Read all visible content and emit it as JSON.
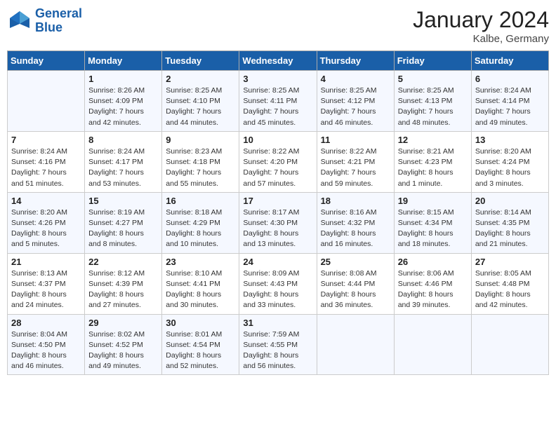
{
  "header": {
    "title": "January 2024",
    "location": "Kalbe, Germany"
  },
  "logo": {
    "line1": "General",
    "line2": "Blue"
  },
  "days_header": [
    "Sunday",
    "Monday",
    "Tuesday",
    "Wednesday",
    "Thursday",
    "Friday",
    "Saturday"
  ],
  "weeks": [
    [
      {
        "day": "",
        "sunrise": "",
        "sunset": "",
        "daylight": ""
      },
      {
        "day": "1",
        "sunrise": "Sunrise: 8:26 AM",
        "sunset": "Sunset: 4:09 PM",
        "daylight": "Daylight: 7 hours and 42 minutes."
      },
      {
        "day": "2",
        "sunrise": "Sunrise: 8:25 AM",
        "sunset": "Sunset: 4:10 PM",
        "daylight": "Daylight: 7 hours and 44 minutes."
      },
      {
        "day": "3",
        "sunrise": "Sunrise: 8:25 AM",
        "sunset": "Sunset: 4:11 PM",
        "daylight": "Daylight: 7 hours and 45 minutes."
      },
      {
        "day": "4",
        "sunrise": "Sunrise: 8:25 AM",
        "sunset": "Sunset: 4:12 PM",
        "daylight": "Daylight: 7 hours and 46 minutes."
      },
      {
        "day": "5",
        "sunrise": "Sunrise: 8:25 AM",
        "sunset": "Sunset: 4:13 PM",
        "daylight": "Daylight: 7 hours and 48 minutes."
      },
      {
        "day": "6",
        "sunrise": "Sunrise: 8:24 AM",
        "sunset": "Sunset: 4:14 PM",
        "daylight": "Daylight: 7 hours and 49 minutes."
      }
    ],
    [
      {
        "day": "7",
        "sunrise": "Sunrise: 8:24 AM",
        "sunset": "Sunset: 4:16 PM",
        "daylight": "Daylight: 7 hours and 51 minutes."
      },
      {
        "day": "8",
        "sunrise": "Sunrise: 8:24 AM",
        "sunset": "Sunset: 4:17 PM",
        "daylight": "Daylight: 7 hours and 53 minutes."
      },
      {
        "day": "9",
        "sunrise": "Sunrise: 8:23 AM",
        "sunset": "Sunset: 4:18 PM",
        "daylight": "Daylight: 7 hours and 55 minutes."
      },
      {
        "day": "10",
        "sunrise": "Sunrise: 8:22 AM",
        "sunset": "Sunset: 4:20 PM",
        "daylight": "Daylight: 7 hours and 57 minutes."
      },
      {
        "day": "11",
        "sunrise": "Sunrise: 8:22 AM",
        "sunset": "Sunset: 4:21 PM",
        "daylight": "Daylight: 7 hours and 59 minutes."
      },
      {
        "day": "12",
        "sunrise": "Sunrise: 8:21 AM",
        "sunset": "Sunset: 4:23 PM",
        "daylight": "Daylight: 8 hours and 1 minute."
      },
      {
        "day": "13",
        "sunrise": "Sunrise: 8:20 AM",
        "sunset": "Sunset: 4:24 PM",
        "daylight": "Daylight: 8 hours and 3 minutes."
      }
    ],
    [
      {
        "day": "14",
        "sunrise": "Sunrise: 8:20 AM",
        "sunset": "Sunset: 4:26 PM",
        "daylight": "Daylight: 8 hours and 5 minutes."
      },
      {
        "day": "15",
        "sunrise": "Sunrise: 8:19 AM",
        "sunset": "Sunset: 4:27 PM",
        "daylight": "Daylight: 8 hours and 8 minutes."
      },
      {
        "day": "16",
        "sunrise": "Sunrise: 8:18 AM",
        "sunset": "Sunset: 4:29 PM",
        "daylight": "Daylight: 8 hours and 10 minutes."
      },
      {
        "day": "17",
        "sunrise": "Sunrise: 8:17 AM",
        "sunset": "Sunset: 4:30 PM",
        "daylight": "Daylight: 8 hours and 13 minutes."
      },
      {
        "day": "18",
        "sunrise": "Sunrise: 8:16 AM",
        "sunset": "Sunset: 4:32 PM",
        "daylight": "Daylight: 8 hours and 16 minutes."
      },
      {
        "day": "19",
        "sunrise": "Sunrise: 8:15 AM",
        "sunset": "Sunset: 4:34 PM",
        "daylight": "Daylight: 8 hours and 18 minutes."
      },
      {
        "day": "20",
        "sunrise": "Sunrise: 8:14 AM",
        "sunset": "Sunset: 4:35 PM",
        "daylight": "Daylight: 8 hours and 21 minutes."
      }
    ],
    [
      {
        "day": "21",
        "sunrise": "Sunrise: 8:13 AM",
        "sunset": "Sunset: 4:37 PM",
        "daylight": "Daylight: 8 hours and 24 minutes."
      },
      {
        "day": "22",
        "sunrise": "Sunrise: 8:12 AM",
        "sunset": "Sunset: 4:39 PM",
        "daylight": "Daylight: 8 hours and 27 minutes."
      },
      {
        "day": "23",
        "sunrise": "Sunrise: 8:10 AM",
        "sunset": "Sunset: 4:41 PM",
        "daylight": "Daylight: 8 hours and 30 minutes."
      },
      {
        "day": "24",
        "sunrise": "Sunrise: 8:09 AM",
        "sunset": "Sunset: 4:43 PM",
        "daylight": "Daylight: 8 hours and 33 minutes."
      },
      {
        "day": "25",
        "sunrise": "Sunrise: 8:08 AM",
        "sunset": "Sunset: 4:44 PM",
        "daylight": "Daylight: 8 hours and 36 minutes."
      },
      {
        "day": "26",
        "sunrise": "Sunrise: 8:06 AM",
        "sunset": "Sunset: 4:46 PM",
        "daylight": "Daylight: 8 hours and 39 minutes."
      },
      {
        "day": "27",
        "sunrise": "Sunrise: 8:05 AM",
        "sunset": "Sunset: 4:48 PM",
        "daylight": "Daylight: 8 hours and 42 minutes."
      }
    ],
    [
      {
        "day": "28",
        "sunrise": "Sunrise: 8:04 AM",
        "sunset": "Sunset: 4:50 PM",
        "daylight": "Daylight: 8 hours and 46 minutes."
      },
      {
        "day": "29",
        "sunrise": "Sunrise: 8:02 AM",
        "sunset": "Sunset: 4:52 PM",
        "daylight": "Daylight: 8 hours and 49 minutes."
      },
      {
        "day": "30",
        "sunrise": "Sunrise: 8:01 AM",
        "sunset": "Sunset: 4:54 PM",
        "daylight": "Daylight: 8 hours and 52 minutes."
      },
      {
        "day": "31",
        "sunrise": "Sunrise: 7:59 AM",
        "sunset": "Sunset: 4:55 PM",
        "daylight": "Daylight: 8 hours and 56 minutes."
      },
      {
        "day": "",
        "sunrise": "",
        "sunset": "",
        "daylight": ""
      },
      {
        "day": "",
        "sunrise": "",
        "sunset": "",
        "daylight": ""
      },
      {
        "day": "",
        "sunrise": "",
        "sunset": "",
        "daylight": ""
      }
    ]
  ]
}
